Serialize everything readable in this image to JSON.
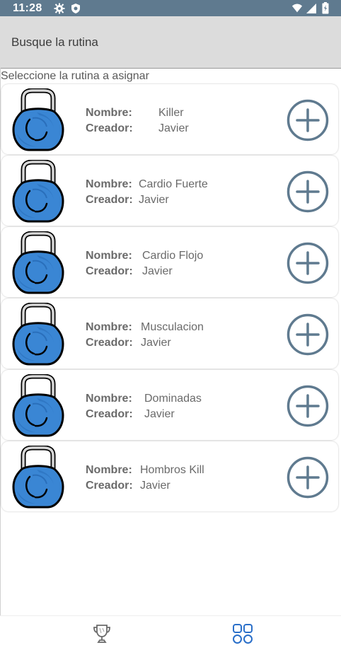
{
  "status_bar": {
    "time": "11:28",
    "icons_left": [
      "gear-icon",
      "shield-icon"
    ],
    "icons_right": [
      "wifi-icon",
      "signal-icon",
      "battery-icon"
    ],
    "background": "#5f7a8f"
  },
  "search": {
    "placeholder": "Busque la rutina"
  },
  "subtitle": "Seleccione la rutina a asignar",
  "labels": {
    "name": "Nombre:",
    "creator": "Creador:"
  },
  "routines": [
    {
      "name": "Killer",
      "creator": "Javier"
    },
    {
      "name": "Cardio Fuerte",
      "creator": "Javier"
    },
    {
      "name": "Cardio Flojo",
      "creator": "Javier"
    },
    {
      "name": "Musculacion",
      "creator": "Javier"
    },
    {
      "name": "Dominadas",
      "creator": "Javier"
    },
    {
      "name": "Hombros Kill",
      "creator": "Javier"
    }
  ],
  "bottom_nav": {
    "items": [
      {
        "icon": "trophy-icon",
        "active": false
      },
      {
        "icon": "grid-icon",
        "active": true
      }
    ],
    "active_color": "#2a6fc9"
  },
  "colors": {
    "accent": "#5f7a8f",
    "kettlebell": "#3a86d4"
  }
}
